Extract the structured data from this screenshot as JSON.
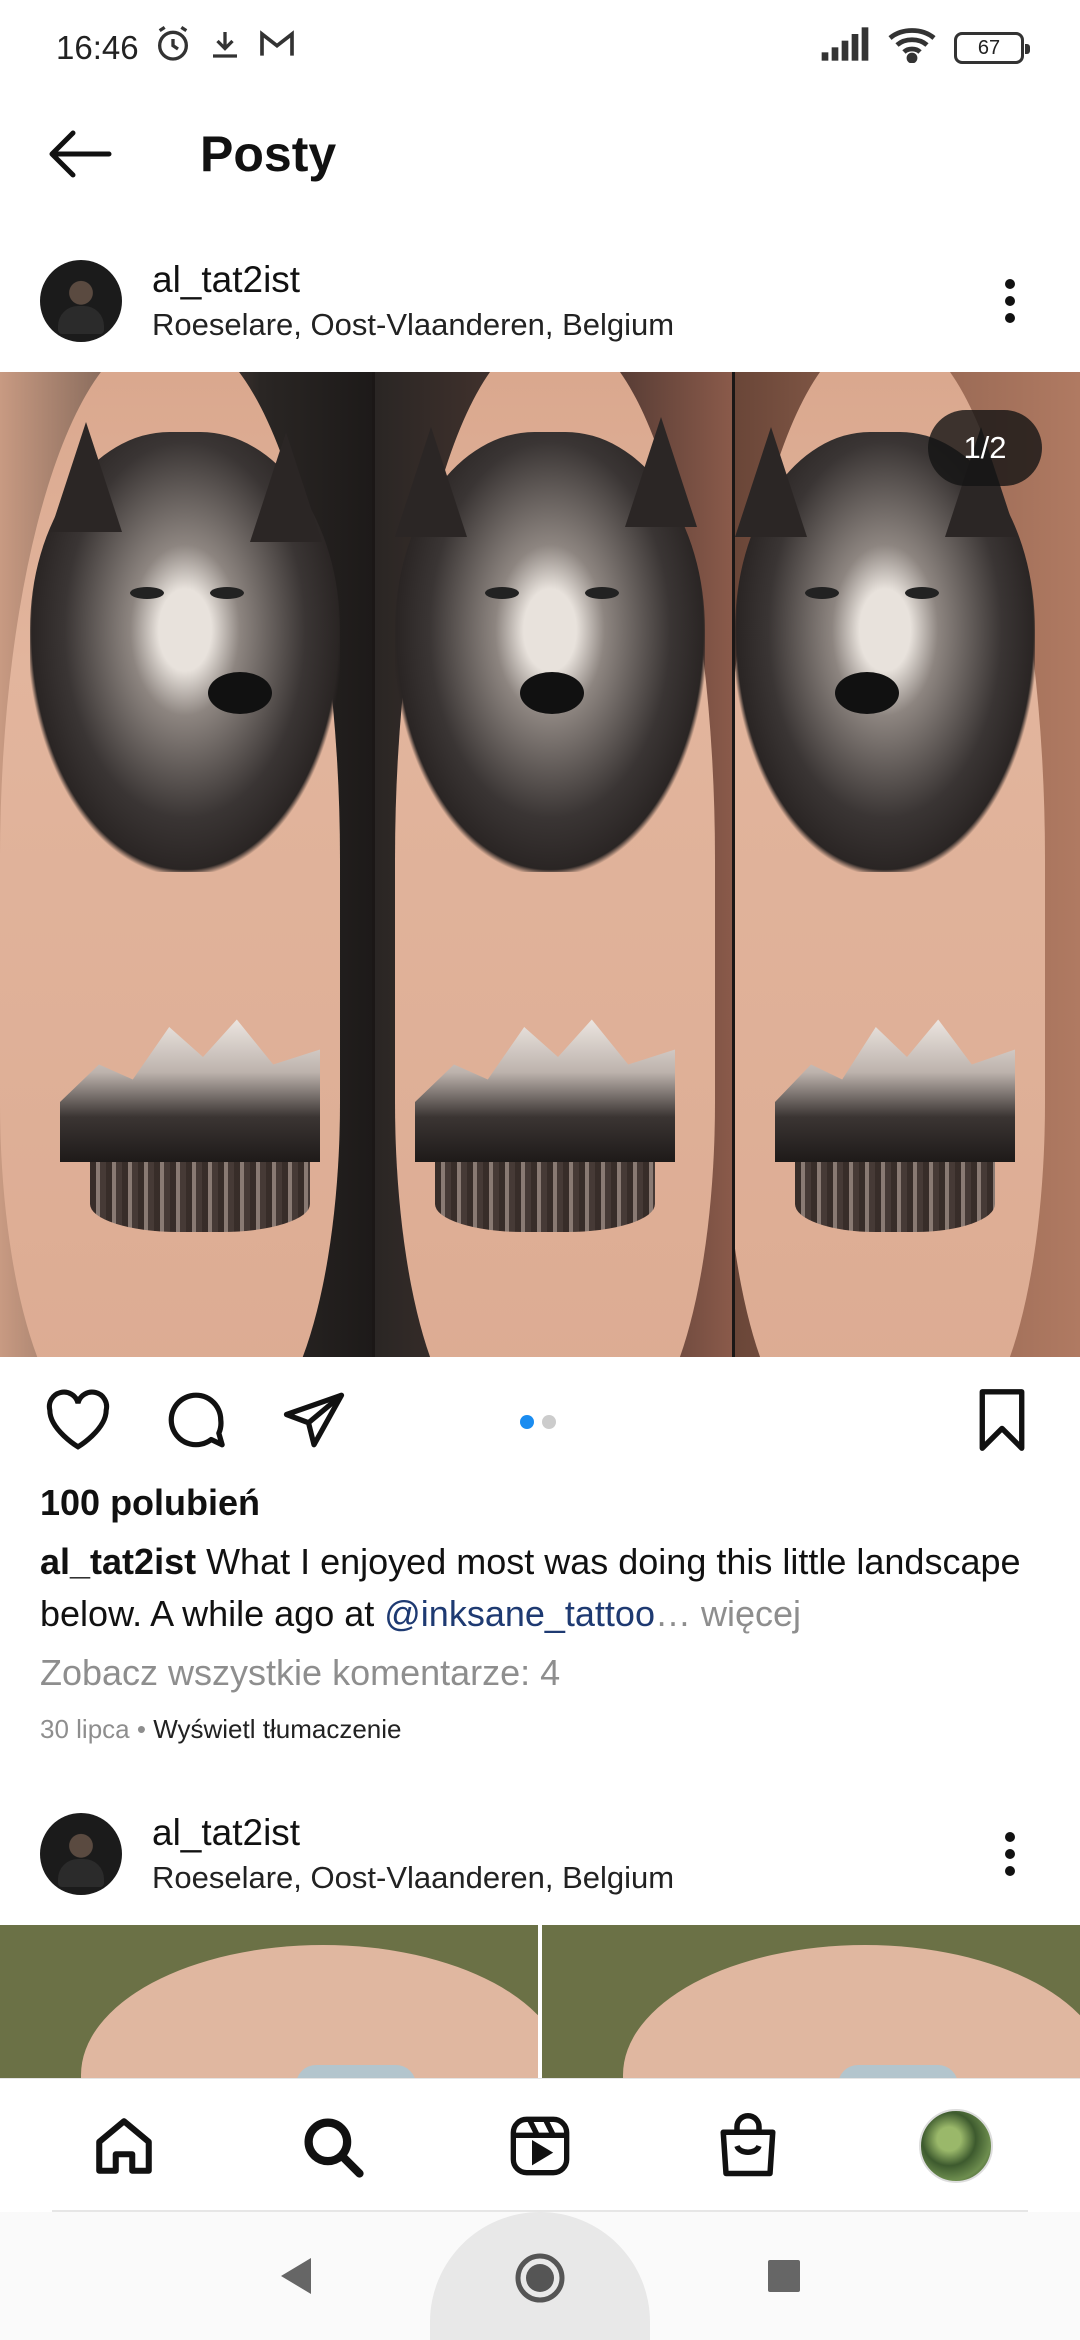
{
  "status_bar": {
    "time": "16:46",
    "battery": "67"
  },
  "header": {
    "title": "Posty"
  },
  "post": {
    "username": "al_tat2ist",
    "location": "Roeselare, Oost-Vlaanderen, Belgium",
    "image_counter": "1/2",
    "likes": "100 polubień",
    "caption_user": "al_tat2ist",
    "caption_text": " What I enjoyed most was doing this little landscape below. A while ago at ",
    "caption_mention": "@inksane_tattoo",
    "caption_more": "… więcej",
    "comments_link": "Zobacz wszystkie komentarze: 4",
    "date": "30 lipca",
    "separator": " • ",
    "translate": "Wyświetl tłumaczenie"
  },
  "next_post": {
    "username": "al_tat2ist",
    "location": "Roeselare, Oost-Vlaanderen, Belgium"
  },
  "colors": {
    "accent_dot": "#1a8cf0",
    "mention": "#1e3a72",
    "muted": "#8e8e8e"
  },
  "icons": {
    "status": [
      "alarm-icon",
      "download-icon",
      "gmail-icon",
      "signal-icon",
      "wifi-icon",
      "battery-icon"
    ],
    "actions": [
      "heart-icon",
      "comment-icon",
      "share-icon",
      "bookmark-icon"
    ],
    "nav": [
      "home-icon",
      "search-icon",
      "reels-icon",
      "shop-icon",
      "profile-avatar"
    ],
    "system": [
      "back-triangle-icon",
      "home-circle-icon",
      "recents-square-icon"
    ]
  }
}
